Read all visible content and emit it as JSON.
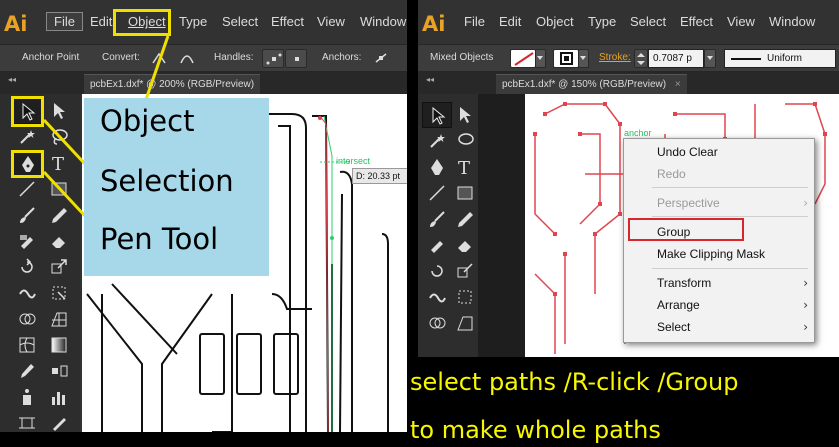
{
  "app": {
    "logo": "Ai"
  },
  "left": {
    "menu": {
      "file": "File",
      "edit": "Edit",
      "object": "Object",
      "type": "Type",
      "select": "Select",
      "effect": "Effect",
      "view": "View",
      "window": "Window"
    },
    "control": {
      "label": "Anchor Point",
      "convert": "Convert:",
      "handles": "Handles:",
      "anchors": "Anchors:"
    },
    "tab": {
      "title": "pcbEx1.dxf* @ 200% (RGB/Preview)",
      "close": "×"
    },
    "canvas_labels": {
      "intersect": "intersect",
      "dimension": "D: 20.33 pt"
    },
    "notes": [
      "Object",
      "Selection",
      "Pen Tool"
    ]
  },
  "right": {
    "menu": {
      "file": "File",
      "edit": "Edit",
      "object": "Object",
      "type": "Type",
      "select": "Select",
      "effect": "Effect",
      "view": "View",
      "window": "Window"
    },
    "control": {
      "label": "Mixed Objects",
      "stroke_label": "Stroke:",
      "stroke_value": "0.7087 p",
      "profile": "Uniform"
    },
    "tab": {
      "title": "pcbEx1.dxf* @ 150% (RGB/Preview)",
      "close": "×"
    },
    "canvas_labels": {
      "anchor": "anchor"
    },
    "context_menu": {
      "undo": "Undo Clear",
      "redo": "Redo",
      "perspective": "Perspective",
      "group": "Group",
      "clipping": "Make Clipping Mask",
      "transform": "Transform",
      "arrange": "Arrange",
      "select": "Select",
      "arrow": "›"
    }
  },
  "caption": {
    "line1": "select paths /R-click /Group",
    "line2": "to make whole paths"
  },
  "colors": {
    "callout": "#f0e000",
    "highlight": "#d6262e",
    "path_red": "#e0454f",
    "logo": "#e9a224"
  }
}
